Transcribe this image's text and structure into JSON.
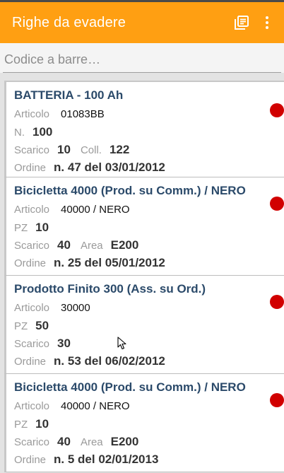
{
  "appbar": {
    "title": "Righe da evadere",
    "icons": [
      "list-icon",
      "more-vert-icon"
    ]
  },
  "search": {
    "placeholder": "Codice a barre…",
    "value": ""
  },
  "colors": {
    "accent": "#ff9f12",
    "title": "#2b4a6a",
    "status_dot": "#d10000"
  },
  "items": [
    {
      "title": "BATTERIA - 100 Ah",
      "articolo_label": "Articolo",
      "articolo": "01083BB",
      "qty_label": "N.",
      "qty": "100",
      "scarico_label": "Scarico",
      "scarico": "10",
      "extra_label": "Coll.",
      "extra": "122",
      "ordine_label": "Ordine",
      "ordine": "n. 47 del 03/01/2012",
      "status": "red"
    },
    {
      "title": "Bicicletta 4000 (Prod. su Comm.) / NERO",
      "articolo_label": "Articolo",
      "articolo": "40000 / NERO",
      "qty_label": "PZ",
      "qty": "10",
      "scarico_label": "Scarico",
      "scarico": "40",
      "extra_label": "Area",
      "extra": "E200",
      "ordine_label": "Ordine",
      "ordine": "n. 25 del 05/01/2012",
      "status": "red"
    },
    {
      "title": "Prodotto Finito 300 (Ass. su Ord.)",
      "articolo_label": "Articolo",
      "articolo": "30000",
      "qty_label": "PZ",
      "qty": "50",
      "scarico_label": "Scarico",
      "scarico": "30",
      "extra_label": "",
      "extra": "",
      "ordine_label": "Ordine",
      "ordine": "n. 53 del 06/02/2012",
      "status": "red"
    },
    {
      "title": "Bicicletta 4000 (Prod. su Comm.) / NERO",
      "articolo_label": "Articolo",
      "articolo": "40000 / NERO",
      "qty_label": "PZ",
      "qty": "10",
      "scarico_label": "Scarico",
      "scarico": "40",
      "extra_label": "Area",
      "extra": "E200",
      "ordine_label": "Ordine",
      "ordine": "n. 5 del 02/01/2013",
      "status": "red"
    }
  ]
}
